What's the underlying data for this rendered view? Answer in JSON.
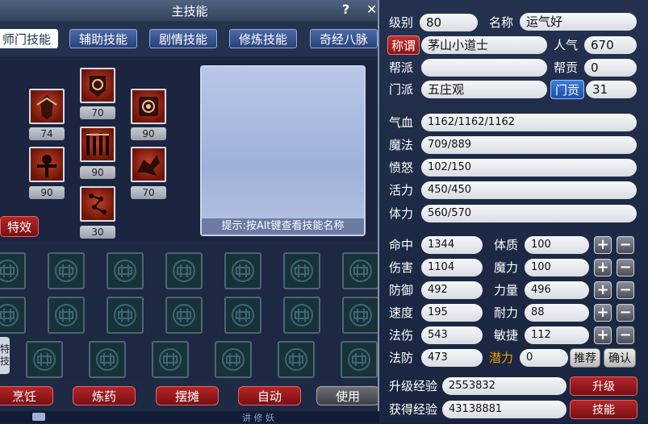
{
  "skill_window": {
    "title": "主技能",
    "help_label": "?",
    "close_label": "✕",
    "tabs": [
      {
        "label": "师门技能",
        "active": true
      },
      {
        "label": "辅助技能",
        "active": false
      },
      {
        "label": "剧情技能",
        "active": false
      },
      {
        "label": "修炼技能",
        "active": false
      },
      {
        "label": "奇经八脉",
        "active": false
      }
    ],
    "skills": [
      {
        "icon": "armored-warrior-icon",
        "level": "74"
      },
      {
        "icon": "swirl-seal-icon",
        "level": "70"
      },
      {
        "icon": "ring-seal-icon",
        "level": "90"
      },
      {
        "icon": "figure-summon-icon",
        "level": "90"
      },
      {
        "icon": "pillar-gate-icon",
        "level": "90"
      },
      {
        "icon": "dragon-beast-icon",
        "level": "70"
      },
      {
        "icon": "rune-chain-icon",
        "level": "30"
      }
    ],
    "hint": "提示:按Alt键查看技能名称",
    "effect_button": "特效",
    "side_tab": "特技",
    "bottom_buttons": [
      {
        "label": "烹饪",
        "style": "red"
      },
      {
        "label": "炼药",
        "style": "red"
      },
      {
        "label": "摆摊",
        "style": "red"
      },
      {
        "label": "自动",
        "style": "red"
      },
      {
        "label": "使用",
        "style": "gray"
      }
    ],
    "bottom_strip_text": "讲 修 妖"
  },
  "character": {
    "level_label": "级别",
    "level": "80",
    "name_label": "名称",
    "name": "运气好",
    "title_label": "称谓",
    "title": "茅山小道士",
    "popularity_label": "人气",
    "popularity": "670",
    "gang_label": "帮派",
    "gang": "",
    "contribution_label": "帮贡",
    "contribution": "0",
    "school_label": "门派",
    "school": "五庄观",
    "school_contribution_label": "门贡",
    "school_contribution": "31",
    "hp_label": "气血",
    "hp": "1162/1162/1162",
    "mp_label": "魔法",
    "mp": "709/889",
    "anger_label": "愤怒",
    "anger": "102/150",
    "vitality_label": "活力",
    "vitality": "450/450",
    "stamina_label": "体力",
    "stamina": "560/570",
    "stats": [
      {
        "label": "命中",
        "value": "1344",
        "attr_label": "体质",
        "attr_value": "100"
      },
      {
        "label": "伤害",
        "value": "1104",
        "attr_label": "魔力",
        "attr_value": "100"
      },
      {
        "label": "防御",
        "value": "492",
        "attr_label": "力量",
        "attr_value": "496"
      },
      {
        "label": "速度",
        "value": "195",
        "attr_label": "耐力",
        "attr_value": "88"
      },
      {
        "label": "法伤",
        "value": "543",
        "attr_label": "敏捷",
        "attr_value": "112"
      }
    ],
    "magic_def_label": "法防",
    "magic_def": "473",
    "potential_label": "潜力",
    "potential": "0",
    "recommend_label": "推荐",
    "confirm_label": "确认",
    "plus_label": "+",
    "minus_label": "−",
    "upgrade_exp_label": "升级经验",
    "upgrade_exp": "2553832",
    "upgrade_button": "升级",
    "gained_exp_label": "获得经验",
    "gained_exp": "43138881",
    "skill_button": "技能"
  },
  "colors": {
    "accent_red": "#9a1c1f",
    "accent_blue": "#2a5fbf",
    "potential_orange": "#f0a000"
  }
}
